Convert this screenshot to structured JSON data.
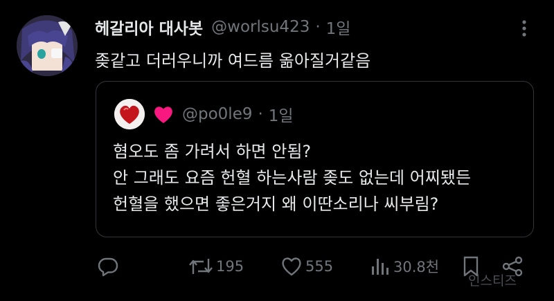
{
  "author": {
    "display_name": "헤갈리아 대사봇",
    "handle": "@worlsu423",
    "separator": "·",
    "time": "1일",
    "avatar_icon": "anime-avatar"
  },
  "tweet": {
    "text": "좆같고 더러우니까 여드름 옮아질거같음"
  },
  "quoted_tweet": {
    "avatar_icon": "heart-avatar",
    "name_icon": "heart-icon",
    "handle": "@po0le9",
    "separator": "·",
    "time": "1일",
    "lines": [
      "혐오도 좀 가려서 하면 안됨?",
      "안 그래도 요즘 헌혈 하는사람 좆도 없는데 어찌됐든",
      "헌혈을 했으면 좋은거지 왜 이딴소리나 씨부림?"
    ]
  },
  "actions": {
    "reply": {
      "icon": "reply-icon",
      "count": ""
    },
    "retweet": {
      "icon": "retweet-icon",
      "count": "195"
    },
    "like": {
      "icon": "heart-outline-icon",
      "count": "555"
    },
    "views": {
      "icon": "views-icon",
      "count": "30.8천"
    },
    "bookmark": {
      "icon": "bookmark-icon"
    },
    "share": {
      "icon": "share-icon"
    }
  },
  "watermark": "인스티즈",
  "colors": {
    "background": "#000000",
    "text": "#e7e9ea",
    "muted": "#71767b",
    "border": "#333639",
    "heart": "#f91880"
  }
}
